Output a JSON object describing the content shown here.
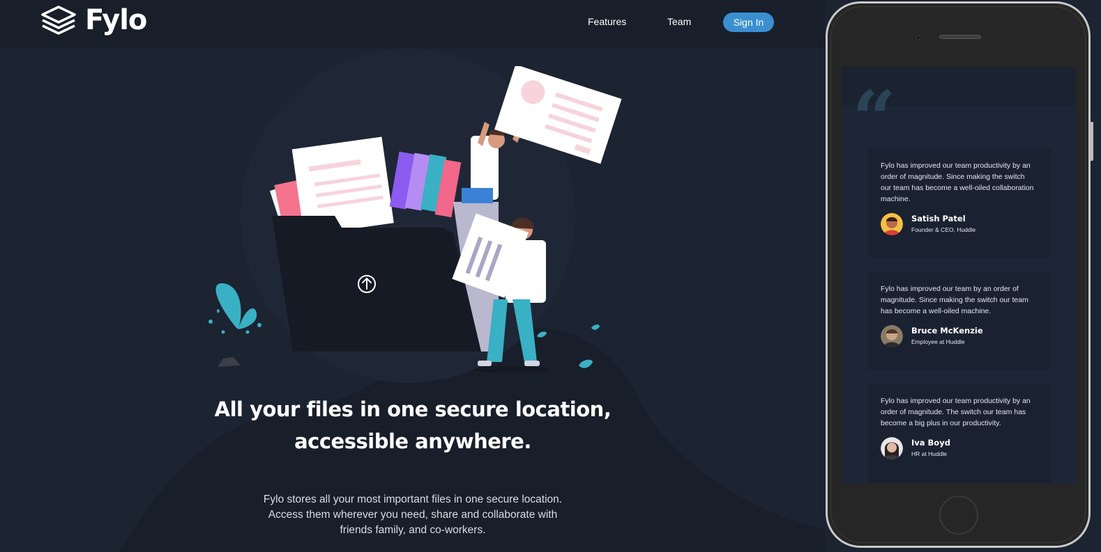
{
  "nav": {
    "brand": "Fylo",
    "links": [
      "Features",
      "Team"
    ],
    "signin": "Sign In"
  },
  "hero": {
    "title_line1": "All your files in one secure location,",
    "title_line2": "accessible anywhere.",
    "description_line1": "Fylo stores all your most important files in one secure location.",
    "description_line2": "Access them wherever you need, share and collaborate with",
    "description_line3": "friends family, and co-workers.",
    "upload_icon": "arrow-up-circle-icon"
  },
  "phone_preview": {
    "quote_icon": "quote-icon",
    "testimonials": [
      {
        "lines": [
          "Fylo has improved our team productivity by an",
          "order of magnitude. Since making the switch",
          "our team has become a well-oiled collaboration",
          "machine."
        ],
        "name": "Satish Patel",
        "role": "Founder & CEO, Huddle"
      },
      {
        "lines": [
          "Fylo has improved our team by an order of",
          "magnitude. Since making the switch our team",
          "has become a well-oiled machine."
        ],
        "name": "Bruce McKenzie",
        "role": "Employee at Huddle"
      },
      {
        "lines": [
          "Fylo has improved our team productivity by an",
          "order of magnitude. The switch our team has",
          "become a big plus in our productivity."
        ],
        "name": "Iva Boyd",
        "role": "HR at Huddle"
      }
    ]
  },
  "colors": {
    "background": "#1c2331",
    "header": "#181f2b",
    "accent": "#3a8fd0",
    "card": "#1a2131",
    "quote": "#2b4455"
  }
}
